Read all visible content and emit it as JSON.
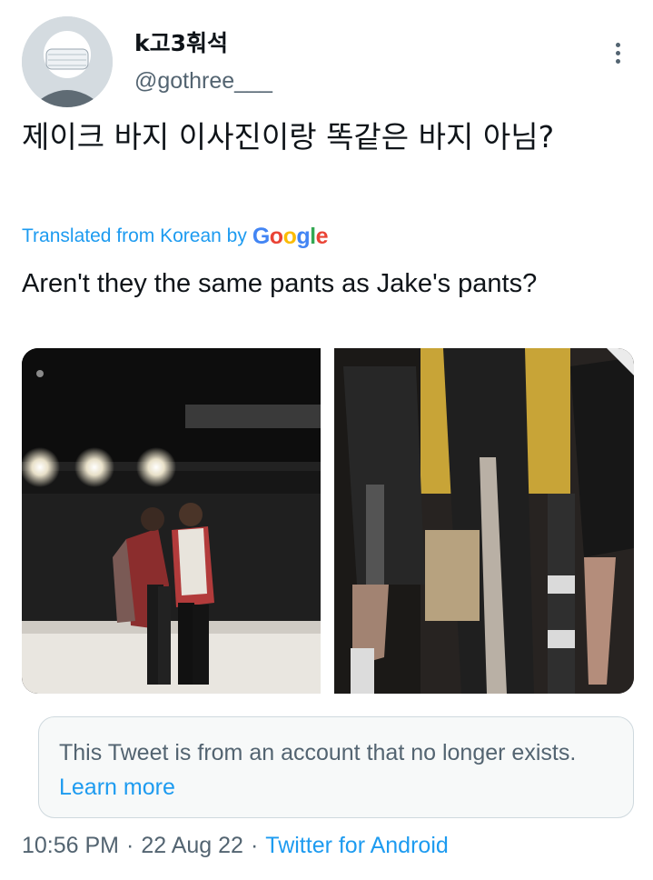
{
  "user": {
    "display_name": "k고3훠석",
    "handle": "@gothree___"
  },
  "tweet": {
    "text": "제이크 바지 이사진이랑 똑같은 바지 아님?",
    "translated_label": "Translated from Korean by",
    "translator_logo": [
      "G",
      "o",
      "o",
      "g",
      "l",
      "e"
    ],
    "translation": "Aren't they the same pants as Jake's pants?"
  },
  "media": {
    "photo_left_alt": "",
    "photo_right_alt": ""
  },
  "notice": {
    "text": "This Tweet is from an account that no longer exists.",
    "link": "Learn more"
  },
  "meta": {
    "time": "10:56 PM",
    "date": "22 Aug 22",
    "separator": "·",
    "source": "Twitter for Android"
  },
  "colors": {
    "link": "#1d9bf0",
    "text": "#0f1419",
    "secondary": "#536471"
  },
  "icons": {
    "more": "more-vertical-icon"
  }
}
